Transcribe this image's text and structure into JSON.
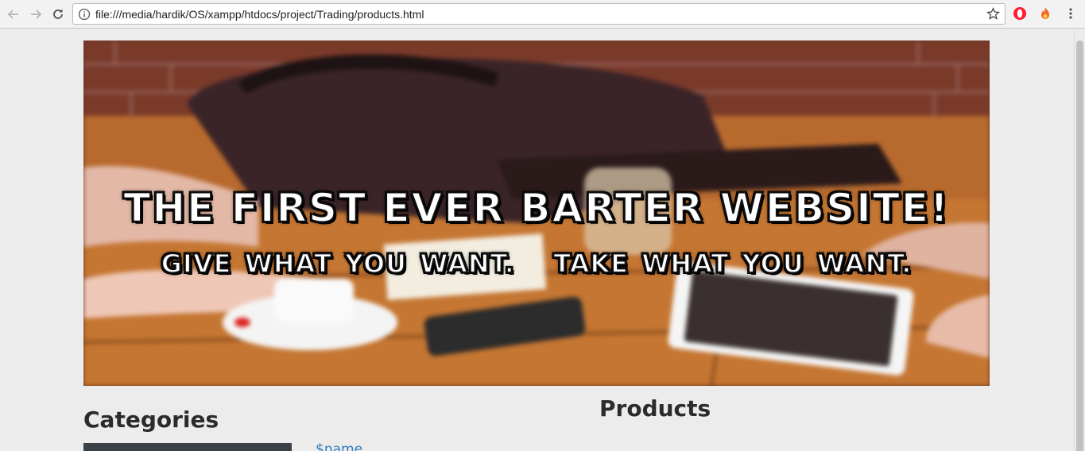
{
  "browser": {
    "url": "file:///media/hardik/OS/xampp/htdocs/project/Trading/products.html",
    "icons": [
      "back-arrow-icon",
      "forward-arrow-icon",
      "reload-icon",
      "info-icon",
      "bookmark-star-icon",
      "opera-extension-icon",
      "fire-extension-icon",
      "kebab-menu-icon"
    ]
  },
  "banner": {
    "title": "THE FIRST EVER BARTER WEBSITE!",
    "tagline": "GIVE WHAT YOU WANT.   TAKE WHAT YOU WANT."
  },
  "main": {
    "categories_heading": "Categories",
    "products_heading": "Products",
    "product_link": "$name"
  },
  "colors": {
    "page_background": "#ececec",
    "link": "#337ab7",
    "category_panel": "#3a4149"
  }
}
